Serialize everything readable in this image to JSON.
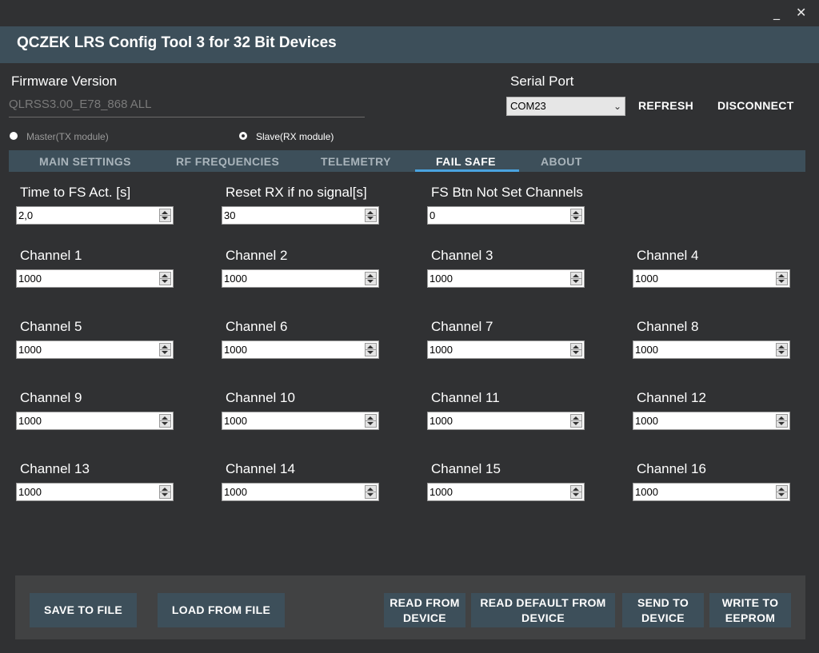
{
  "window": {
    "title": "QCZEK LRS Config Tool 3 for 32 Bit Devices",
    "minimize_glyph": "_",
    "close_glyph": "✕"
  },
  "firmware": {
    "label": "Firmware Version",
    "value": "QLRSS3.00_E78_868 ALL"
  },
  "serial": {
    "label": "Serial Port",
    "selected": "COM23",
    "refresh_label": "REFRESH",
    "disconnect_label": "DISCONNECT"
  },
  "mode": {
    "master_label": "Master(TX module)",
    "slave_label": "Slave(RX module)",
    "selected": "slave"
  },
  "tabs": [
    {
      "label": "MAIN SETTINGS"
    },
    {
      "label": "RF FREQUENCIES"
    },
    {
      "label": "TELEMETRY"
    },
    {
      "label": "FAIL SAFE",
      "active": true
    },
    {
      "label": "ABOUT"
    }
  ],
  "failsafe": {
    "time_label": "Time to FS Act. [s]",
    "time_value": "2,0",
    "reset_label": "Reset RX if no signal[s]",
    "reset_value": "30",
    "btn_label": "FS Btn Not Set Channels",
    "btn_value": "0",
    "channels": [
      {
        "label": "Channel 1",
        "value": "1000"
      },
      {
        "label": "Channel 2",
        "value": "1000"
      },
      {
        "label": "Channel 3",
        "value": "1000"
      },
      {
        "label": "Channel 4",
        "value": "1000"
      },
      {
        "label": "Channel 5",
        "value": "1000"
      },
      {
        "label": "Channel 6",
        "value": "1000"
      },
      {
        "label": "Channel 7",
        "value": "1000"
      },
      {
        "label": "Channel 8",
        "value": "1000"
      },
      {
        "label": "Channel 9",
        "value": "1000"
      },
      {
        "label": "Channel 10",
        "value": "1000"
      },
      {
        "label": "Channel 11",
        "value": "1000"
      },
      {
        "label": "Channel 12",
        "value": "1000"
      },
      {
        "label": "Channel 13",
        "value": "1000"
      },
      {
        "label": "Channel 14",
        "value": "1000"
      },
      {
        "label": "Channel 15",
        "value": "1000"
      },
      {
        "label": "Channel 16",
        "value": "1000"
      }
    ]
  },
  "footer": {
    "save_file": "SAVE TO FILE",
    "load_file": "LOAD FROM FILE",
    "read_device": "READ FROM\nDEVICE",
    "read_default": "READ DEFAULT FROM\nDEVICE",
    "send_device": "SEND TO\nDEVICE",
    "write_eeprom": "WRITE TO\nEEPROM"
  },
  "colors": {
    "background": "#303133",
    "header": "#3d4f5a",
    "tab_accent": "#4aa3df",
    "footer": "#414243"
  }
}
